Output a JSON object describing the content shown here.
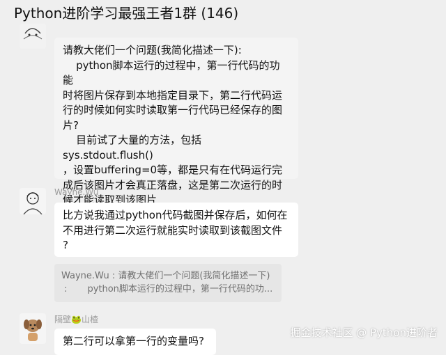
{
  "window": {
    "title": "Python进阶学习最强王者1群 (146)"
  },
  "messages": [
    {
      "sender": "",
      "lines": [
        "请教大佬们一个问题(我简化描述一下):",
        "    python脚本运行的过程中，第一行代码的功能",
        "时将图片保存到本地指定目录下，第二行代码运",
        "行的时候如何实时读取第一行代码已经保存的图",
        "片?",
        "    目前试了大量的方法，包括sys.stdout.flush()",
        "，设置buffering=0等，都是只有在代码运行完",
        "成后该图片才会真正落盘，这是第二次运行的时",
        "候才能读取到该图片"
      ]
    },
    {
      "sender": "Wayne.Wu",
      "lines": [
        "比方说我通过python代码截图并保存后，如何在",
        "不用进行第二次运行就能实时读取到该截图文件",
        "?"
      ],
      "quote_lines": [
        "Wayne.Wu : 请教大佬们一个问题(我简化描述一下)",
        " :       python脚本运行的过程中，第一行代码的功..."
      ]
    },
    {
      "sender": "隔壁🐸山楂",
      "lines": [
        "第二行可以拿第一行的变量吗?"
      ]
    }
  ],
  "watermark": "掘金技术社区 @ Python进阶者",
  "colors": {
    "background": "#efefef",
    "bubble": "#ffffff",
    "quote": "#e6e6e6",
    "sender_name": "#9b9b9b"
  }
}
